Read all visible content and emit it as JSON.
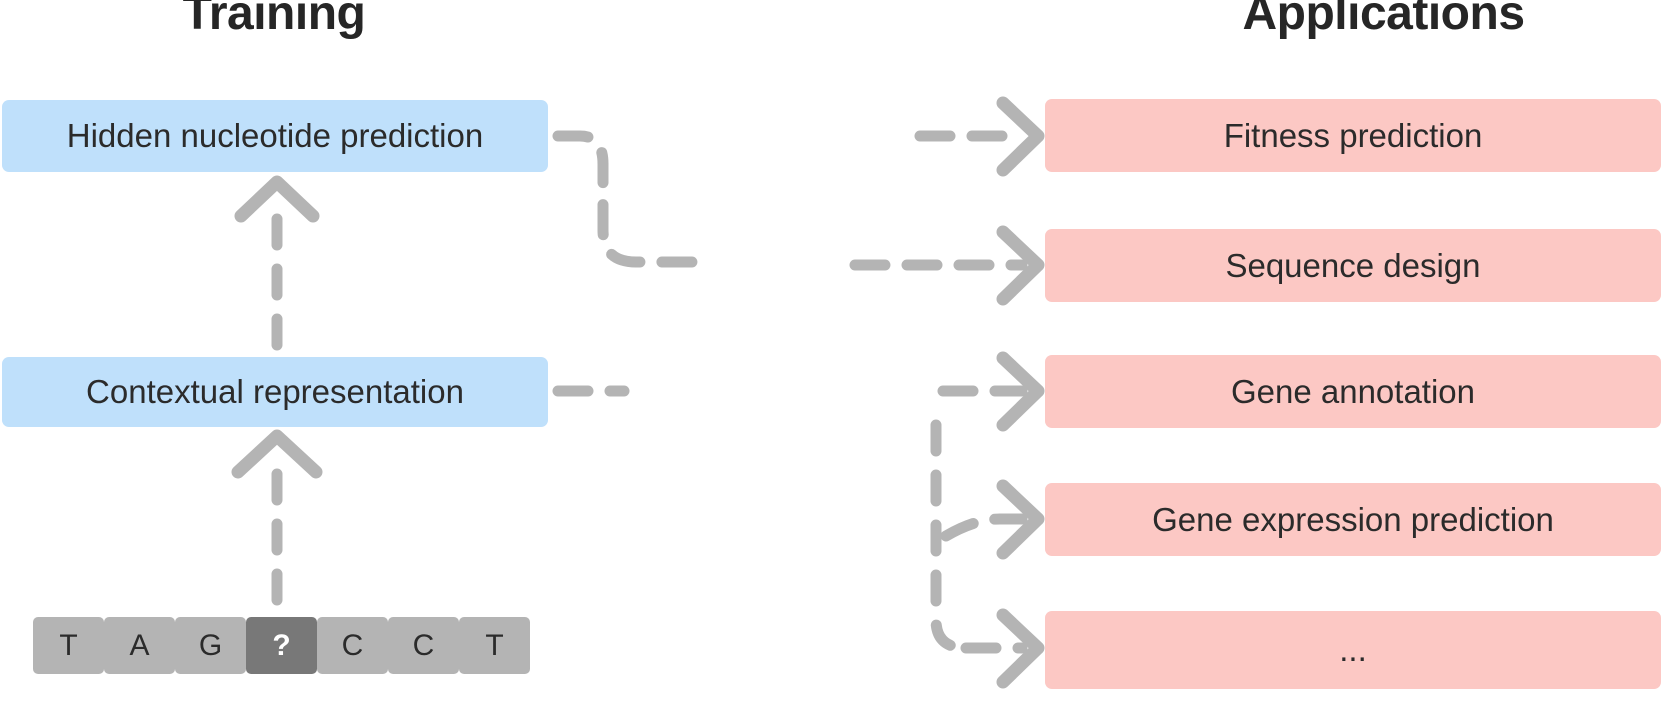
{
  "headings": {
    "training": "Training",
    "applications": "Applications"
  },
  "training_nodes": [
    {
      "id": "hidden",
      "label": "Hidden nucleotide prediction"
    },
    {
      "id": "contextual",
      "label": "Contextual representation"
    }
  ],
  "application_nodes": [
    {
      "id": "fitness",
      "label": "Fitness prediction"
    },
    {
      "id": "seqdesign",
      "label": "Sequence design"
    },
    {
      "id": "geneannot",
      "label": "Gene annotation"
    },
    {
      "id": "geneexpr",
      "label": "Gene expression prediction"
    },
    {
      "id": "ellipsis",
      "label": "..."
    }
  ],
  "sequence": {
    "tokens": [
      "T",
      "A",
      "G",
      "?",
      "C",
      "C",
      "T"
    ],
    "masked_index": 3
  },
  "colors": {
    "blue_box": "#bfe0fb",
    "pink_box": "#fcc8c4",
    "sequence_cell": "#b4b4b4",
    "masked_cell": "#787878",
    "arrow": "#b4b4b4",
    "text": "#2b2b2b",
    "heading_text": "#262626",
    "background": "#ffffff"
  },
  "icons": {
    "up_arrow": "arrow-up-icon",
    "right_arrow": "arrow-right-icon",
    "dashed_connector": "dashed-connector-icon"
  }
}
